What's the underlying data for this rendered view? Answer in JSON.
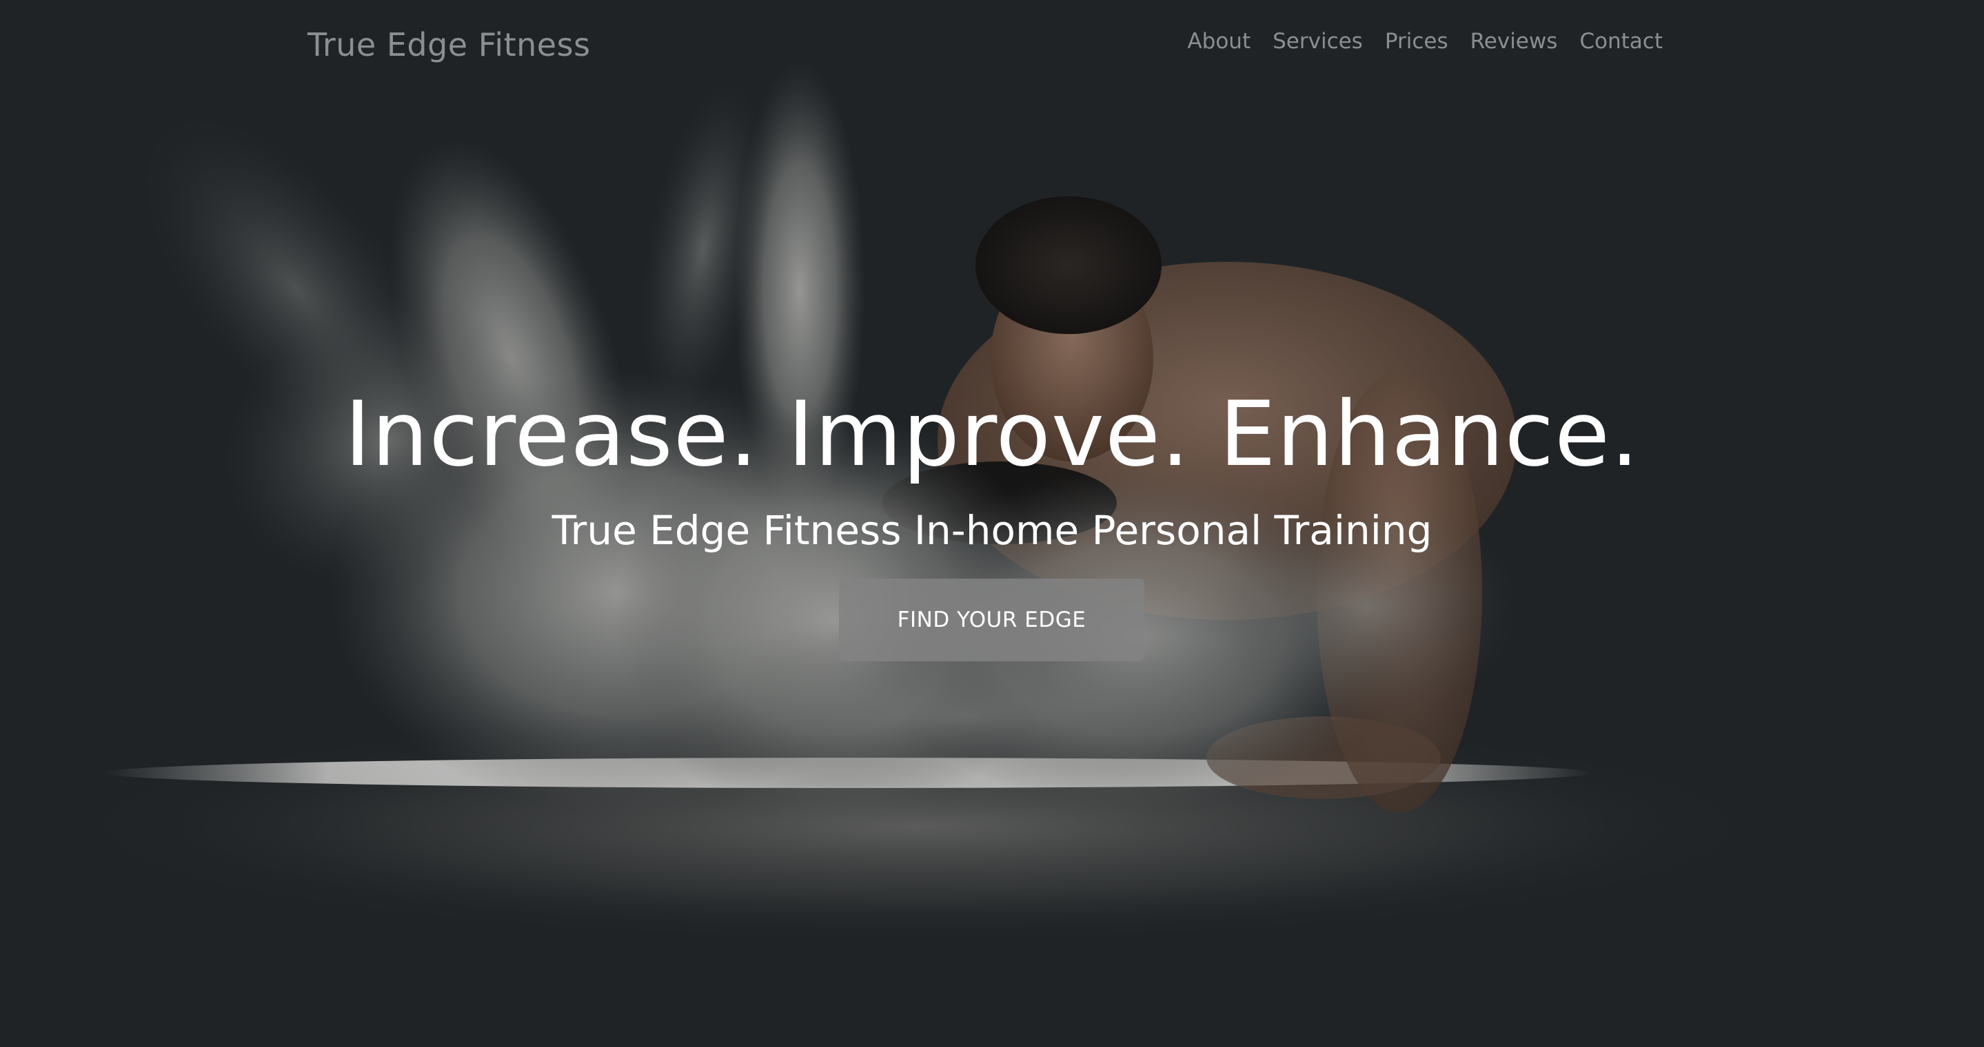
{
  "header": {
    "brand": "True Edge Fitness",
    "nav": [
      {
        "label": "About"
      },
      {
        "label": "Services"
      },
      {
        "label": "Prices"
      },
      {
        "label": "Reviews"
      },
      {
        "label": "Contact"
      }
    ]
  },
  "hero": {
    "headline": "Increase. Improve. Enhance.",
    "subheadline": "True Edge Fitness In-home Personal Training",
    "cta_label": "FIND YOUR EDGE",
    "image_icon": "chalk-dust-athlete-photo"
  },
  "colors": {
    "background": "#1f2326",
    "nav_text": "#8c8f90",
    "hero_text": "#ffffff",
    "button": "#828282"
  }
}
